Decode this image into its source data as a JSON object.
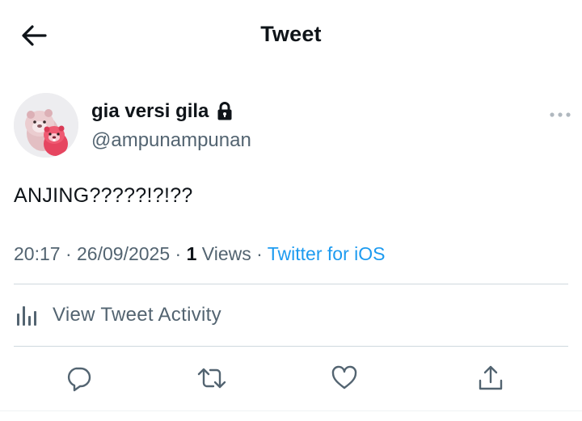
{
  "header": {
    "title": "Tweet"
  },
  "tweet": {
    "author_name": "gia versi gila",
    "author_handle": "@ampunampunan",
    "locked": true,
    "text": "ANJING?????!?!??",
    "time": "20:17",
    "date": "26/09/2025",
    "views_count": "1",
    "views_label": "Views",
    "source": "Twitter for iOS",
    "separator": "·"
  },
  "activity": {
    "label": "View Tweet Activity"
  },
  "actions": [
    "reply-icon",
    "retweet-icon",
    "like-icon",
    "share-icon"
  ],
  "colors": {
    "text_primary": "#0f1419",
    "text_secondary": "#536471",
    "link": "#1d9bf0",
    "divider": "#cfd9de"
  }
}
